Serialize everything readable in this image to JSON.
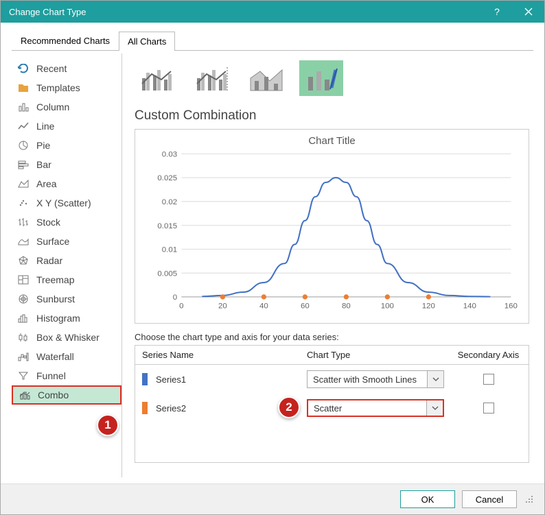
{
  "titlebar": {
    "title": "Change Chart Type"
  },
  "tabs": {
    "recommended": "Recommended Charts",
    "all": "All Charts"
  },
  "sidebar": {
    "items": [
      {
        "label": "Recent"
      },
      {
        "label": "Templates"
      },
      {
        "label": "Column"
      },
      {
        "label": "Line"
      },
      {
        "label": "Pie"
      },
      {
        "label": "Bar"
      },
      {
        "label": "Area"
      },
      {
        "label": "X Y (Scatter)"
      },
      {
        "label": "Stock"
      },
      {
        "label": "Surface"
      },
      {
        "label": "Radar"
      },
      {
        "label": "Treemap"
      },
      {
        "label": "Sunburst"
      },
      {
        "label": "Histogram"
      },
      {
        "label": "Box & Whisker"
      },
      {
        "label": "Waterfall"
      },
      {
        "label": "Funnel"
      },
      {
        "label": "Combo"
      }
    ]
  },
  "main": {
    "section_title": "Custom Combination",
    "preview_title": "Chart Title",
    "instructions": "Choose the chart type and axis for your data series:",
    "table_headers": {
      "name": "Series Name",
      "type": "Chart Type",
      "axis": "Secondary Axis"
    },
    "series": [
      {
        "name": "Series1",
        "type": "Scatter with Smooth Lines",
        "swatch": "#4472c4",
        "secondary": false
      },
      {
        "name": "Series2",
        "type": "Scatter",
        "swatch": "#ed7d31",
        "secondary": false
      }
    ]
  },
  "footer": {
    "ok": "OK",
    "cancel": "Cancel"
  },
  "callouts": {
    "one": "1",
    "two": "2"
  },
  "chart_data": {
    "type": "scatter+line",
    "title": "Chart Title",
    "xlabel": "",
    "ylabel": "",
    "xlim": [
      0,
      160
    ],
    "ylim": [
      0,
      0.03
    ],
    "x_ticks": [
      0,
      20,
      40,
      60,
      80,
      100,
      120,
      140,
      160
    ],
    "y_ticks": [
      0,
      0.005,
      0.01,
      0.015,
      0.02,
      0.025,
      0.03
    ],
    "series": [
      {
        "name": "Series1",
        "render": "smooth_line",
        "color": "#4472c4",
        "x": [
          10,
          20,
          30,
          40,
          50,
          55,
          60,
          65,
          70,
          75,
          80,
          85,
          90,
          95,
          100,
          110,
          120,
          130,
          140,
          150
        ],
        "y": [
          0.0001,
          0.0003,
          0.001,
          0.003,
          0.007,
          0.011,
          0.016,
          0.021,
          0.024,
          0.025,
          0.024,
          0.021,
          0.016,
          0.011,
          0.007,
          0.003,
          0.001,
          0.0003,
          0.0001,
          5e-05
        ]
      },
      {
        "name": "Series2",
        "render": "points",
        "color": "#ed7d31",
        "x": [
          20,
          40,
          60,
          80,
          100,
          120
        ],
        "y": [
          0,
          0,
          0,
          0,
          0,
          0
        ]
      }
    ]
  }
}
